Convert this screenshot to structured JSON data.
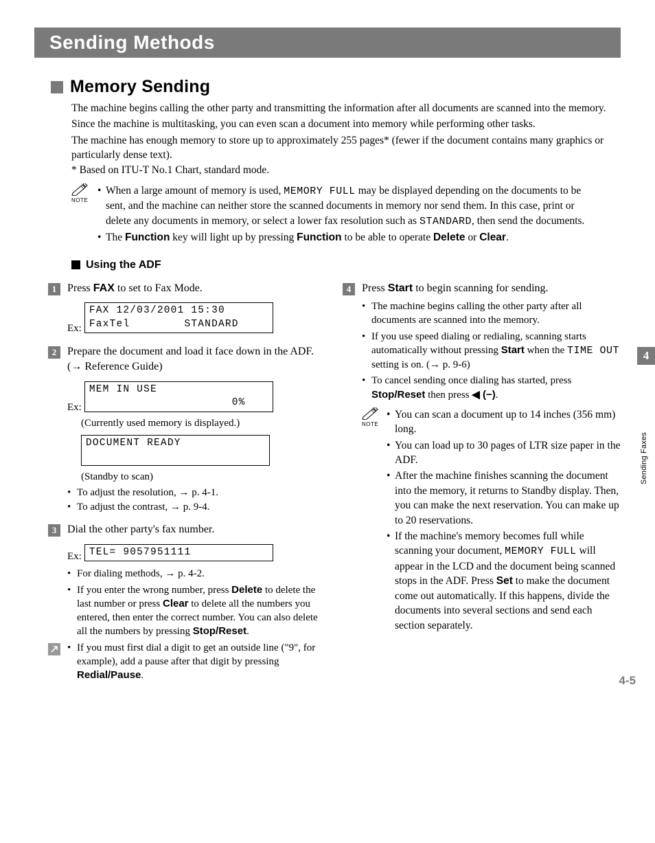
{
  "title": "Sending Methods",
  "section": {
    "title": "Memory Sending"
  },
  "intro": {
    "p1": "The machine begins calling the other party and transmitting the information after all documents are scanned into the memory.",
    "p2": "Since the machine is multitasking, you can even scan a document into memory while performing other tasks.",
    "p3": "The machine has enough memory to store up to approximately 255 pages* (fewer if the document contains many graphics or particularly dense text).",
    "footnote": "* Based on ITU-T No.1 Chart, standard mode."
  },
  "note_label": "NOTE",
  "note1": {
    "li1_a": "When a large amount of memory is used, ",
    "li1_code1": "MEMORY FULL",
    "li1_b": " may be displayed depending on the documents to be sent, and the machine can neither store the scanned documents in memory nor send them. In this case, print or delete any documents in memory, or select a lower fax resolution such as ",
    "li1_code2": "STANDARD",
    "li1_c": ", then send the documents.",
    "li2_a": "The ",
    "li2_b1": "Function",
    "li2_c": " key will light up by pressing ",
    "li2_b2": "Function",
    "li2_d": " to be able to operate ",
    "li2_b3": "Delete",
    "li2_e": " or ",
    "li2_b4": "Clear",
    "li2_f": "."
  },
  "subsection": "Using the ADF",
  "step1": {
    "a": "Press ",
    "b": "FAX",
    "c": " to set to Fax Mode."
  },
  "ex": "Ex:",
  "lcd1": "FAX 12/03/2001 15:30\nFaxTel        STANDARD",
  "step2": {
    "a": "Prepare the document and load it face down in the ADF. (→ Reference Guide)"
  },
  "lcd2": "MEM IN USE\n                     0%",
  "caption2": "(Currently used memory is displayed.)",
  "lcd3": "DOCUMENT READY\n ",
  "caption3": "(Standby to scan)",
  "step2_bullets": {
    "b1": "To adjust the resolution, → p. 4-1.",
    "b2": "To adjust the contrast, → p. 9-4."
  },
  "step3": {
    "a": "Dial the other party's fax number."
  },
  "lcd4": "TEL=        9057951111",
  "step3_bullets": {
    "b1": "For dialing methods, → p. 4-2.",
    "b2_a": "If you enter the wrong number, press ",
    "b2_b1": "Delete",
    "b2_b": " to delete the last number or press ",
    "b2_b2": "Clear",
    "b2_c": " to delete all the numbers you entered, then enter the correct number. You can also delete all the numbers by pressing ",
    "b2_b3": "Stop/Reset",
    "b2_d": ".",
    "b3_a": "If you must first dial a digit to get an outside line (\"9\", for example), add a pause after that digit by pressing ",
    "b3_b": "Redial/Pause",
    "b3_c": "."
  },
  "step4": {
    "a": "Press ",
    "b": "Start",
    "c": " to begin scanning for sending."
  },
  "step4_bullets": {
    "b1": "The machine begins calling the other party after all documents are scanned into the memory.",
    "b2_a": "If you use speed dialing or redialing, scanning starts automatically without pressing ",
    "b2_b": "Start",
    "b2_c": " when the ",
    "b2_code": "TIME OUT",
    "b2_d": " setting is on. (→ p. 9-6)",
    "b3_a": "To cancel sending once dialing has started, press ",
    "b3_b1": "Stop/Reset",
    "b3_b": " then press ",
    "b3_b2": "◀ (−)",
    "b3_c": "."
  },
  "note2": {
    "li1": "You can scan a document up to 14 inches (356 mm) long.",
    "li2": "You can load up to 30 pages of LTR size paper in the ADF.",
    "li3": "After the machine finishes scanning the document into the memory, it returns to Standby display. Then, you can make the next reservation. You can make up to 20 reservations.",
    "li4_a": "If the machine's memory becomes full while scanning your document, ",
    "li4_code": "MEMORY FULL",
    "li4_b": " will appear in the LCD and the document being scanned stops in the ADF. Press ",
    "li4_bold": "Set",
    "li4_c": " to make the document come out automatically. If this happens, divide the documents into several sections and send each section separately."
  },
  "tab": {
    "num": "4",
    "label": "Sending Faxes"
  },
  "page_num": "4-5"
}
